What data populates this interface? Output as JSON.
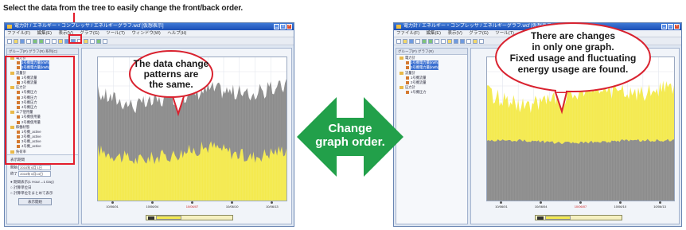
{
  "caption": "Select the data from the tree to easily change the front/back order.",
  "left_window": {
    "title": "電力計 / エネルギー・コンプレッサ / エネルギーグラフ.wcf [仮想表示]",
    "menu": [
      "ファイル(F)",
      "編集(E)",
      "表示(V)",
      "グラフ(G)",
      "ツール(T)",
      "ウィンドウ(W)",
      "ヘルプ(H)"
    ],
    "sidebar_tabs": "グループ(P)   グラフ(R)   系列(C)",
    "tree": [
      {
        "label": "電力計",
        "level": 1,
        "type": "folder"
      },
      {
        "label": "1号機電力量(kWh)",
        "level": 2,
        "type": "leaf",
        "selected": true
      },
      {
        "label": "2号機電力量(kWh)",
        "level": 2,
        "type": "leaf",
        "selected": true
      },
      {
        "label": "流量計",
        "level": 1,
        "type": "folder"
      },
      {
        "label": "1号機流量",
        "level": 2,
        "type": "leaf"
      },
      {
        "label": "2号機流量",
        "level": 2,
        "type": "leaf"
      },
      {
        "label": "圧力計",
        "level": 1,
        "type": "folder"
      },
      {
        "label": "1号機圧力",
        "level": 2,
        "type": "leaf"
      },
      {
        "label": "2号機圧力",
        "level": 2,
        "type": "leaf"
      },
      {
        "label": "3号機圧力",
        "level": 2,
        "type": "leaf"
      },
      {
        "label": "4号機圧力",
        "level": 2,
        "type": "leaf"
      },
      {
        "label": "エア使用量",
        "level": 1,
        "type": "folder"
      },
      {
        "label": "1号機使用量",
        "level": 2,
        "type": "leaf"
      },
      {
        "label": "2号機使用量",
        "level": 2,
        "type": "leaf"
      },
      {
        "label": "稼働状態",
        "level": 1,
        "type": "folder"
      },
      {
        "label": "1号機_active",
        "level": 2,
        "type": "leaf"
      },
      {
        "label": "2号機_active",
        "level": 2,
        "type": "leaf"
      },
      {
        "label": "3号機_active",
        "level": 2,
        "type": "leaf"
      },
      {
        "label": "4号機_active",
        "level": 2,
        "type": "leaf"
      },
      {
        "label": "負荷率",
        "level": 1,
        "type": "folder"
      },
      {
        "label": "1号機_load",
        "level": 2,
        "type": "leaf"
      },
      {
        "label": "2号機_load",
        "level": 2,
        "type": "leaf"
      },
      {
        "label": "3号機_load",
        "level": 2,
        "type": "leaf"
      },
      {
        "label": "4号機_load",
        "level": 2,
        "type": "leaf"
      }
    ],
    "side_panel": {
      "section": "表示期間",
      "start_label": "開始",
      "start_value": "2010年 6月 1日",
      "end_label": "終了",
      "end_value": "2010年 6月14日",
      "opt1": "期間表示(1 Hour→1 Day)",
      "opt2": "計算単位日",
      "opt3": "計算単位をまとめて表示",
      "button": "表示開始"
    },
    "x_labels": [
      "10/06/01",
      "10/06/04",
      "10/06/07",
      "10/06/10",
      "10/06/13"
    ],
    "bubble": [
      "The data change",
      "patterns are",
      "the same."
    ]
  },
  "right_window": {
    "title": "電力計 / エネルギー・コンプレッサ / エネルギーグラフ.wcf [仮想表示]",
    "menu": [
      "ファイル(F)",
      "編集(E)",
      "表示(V)",
      "グラフ(G)",
      "ツール(T)",
      "ウィンドウ(W)",
      "ヘルプ(H)"
    ],
    "sidebar_tabs": "グループ(P)   グラフ(R)",
    "x_labels": [
      "10/06/01",
      "10/06/04",
      "10/06/07",
      "10/06/10",
      "10/06/13"
    ],
    "bubble": [
      "There are changes",
      "in only one graph.",
      "Fixed usage and fluctuating",
      "energy usage are found."
    ]
  },
  "center_arrow": {
    "line1": "Change",
    "line2": "graph order.",
    "color": "#22a04a"
  },
  "colors": {
    "highlight": "#e31d2b",
    "series_gray": "#8c8c8c",
    "series_yellow": "#f4ea4e",
    "title_blue": "#2a5fc4"
  },
  "chart_data": [
    {
      "type": "area",
      "title": "",
      "stacked": true,
      "x": [
        "10/06/01",
        "10/06/04",
        "10/06/07",
        "10/06/10",
        "10/06/13"
      ],
      "series": [
        {
          "color": "#f4ea4e",
          "values": [
            0.35,
            0.28,
            0.32,
            0.38,
            0.3,
            0.36
          ]
        },
        {
          "color": "#8c8c8c",
          "values": [
            0.75,
            0.66,
            0.72,
            0.78,
            0.74,
            0.8
          ]
        }
      ]
    },
    {
      "type": "area",
      "title": "",
      "stacked": true,
      "x": [
        "10/06/01",
        "10/06/04",
        "10/06/07",
        "10/06/10",
        "10/06/13"
      ],
      "series": [
        {
          "color": "#8c8c8c",
          "values": [
            0.42,
            0.42,
            0.4,
            0.41,
            0.42,
            0.42
          ]
        },
        {
          "color": "#f4ea4e",
          "values": [
            0.75,
            0.66,
            0.72,
            0.78,
            0.74,
            0.8
          ]
        }
      ]
    }
  ]
}
